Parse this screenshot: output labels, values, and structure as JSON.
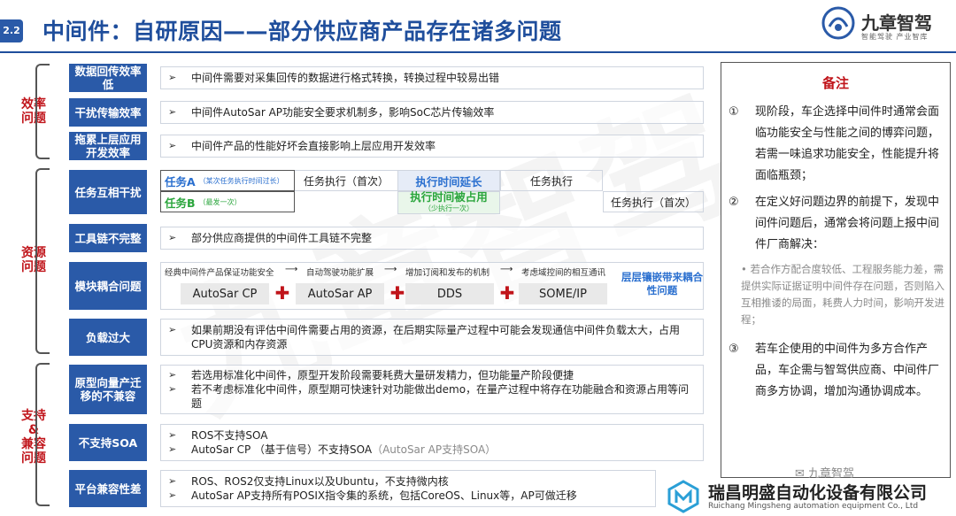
{
  "header": {
    "badge": "2.2",
    "title": "中间件：自研原因——部分供应商产品存在诸多问题",
    "logo_name": "九章智驾",
    "logo_slogan": "智能驾驶 产业智库"
  },
  "watermark": "九章智驾",
  "groups": [
    {
      "label": "效率\n问题"
    },
    {
      "label": "资源\n问题"
    },
    {
      "label": "支持\n&\n兼容\n问题"
    }
  ],
  "rows": {
    "r1": {
      "label": "数据回传效率低",
      "text": "中间件需要对采集回传的数据进行格式转换，转换过程中较易出错"
    },
    "r2": {
      "label": "干扰传输效率",
      "text": "中间件AutoSar AP功能安全要求机制多，影响SoC芯片传输效率"
    },
    "r3": {
      "label": "拖累上层应用开发效率",
      "text": "中间件产品的性能好坏会直接影响上层应用开发效率"
    },
    "r4": {
      "label": "任务互相干扰",
      "taskA": "任务A",
      "taskA_note": "（某次任务执行时间过长）",
      "taskB": "任务B",
      "taskB_note": "（最发一次）",
      "exec_first_a": "任务执行（首次）",
      "time_extend": "执行时间延长",
      "time_occupied": "执行时间被占用",
      "time_occupied_note": "（少执行一次）",
      "exec_a": "任务执行",
      "exec_first_b": "任务执行（首次）"
    },
    "r5": {
      "label": "工具链不完整",
      "text": "部分供应商提供的中间件工具链不完整"
    },
    "r6": {
      "label": "模块耦合问题",
      "chain": [
        "经典中间件产品保证功能安全",
        "自动驾驶功能扩展",
        "增加订阅和发布的机制",
        "考虑域控间的相互通讯"
      ],
      "modules": [
        "AutoSar CP",
        "AutoSar AP",
        "DDS",
        "SOME/IP"
      ],
      "side_note": "层层镶嵌带来耦合性问题"
    },
    "r7": {
      "label": "负载过大",
      "text": "如果前期没有评估中间件需要占用的资源，在后期实际量产过程中可能会发现通信中间件负载太大，占用CPU资源和内存资源"
    },
    "r8": {
      "label": "原型向量产迁移的不兼容",
      "lines": [
        "若选用标准化中间件，原型开发阶段需要耗费大量研发精力，但功能量产阶段便捷",
        "若不考虑标准化中间件，原型期可快速针对功能做出demo，在量产过程中将存在功能融合和资源占用等问题"
      ]
    },
    "r9": {
      "label": "不支持SOA",
      "line1": "ROS不支持SOA",
      "line2_main": "AutoSar CP （基于信号）不支持SOA",
      "line2_muted": "（AutoSar AP支持SOA）"
    },
    "r10": {
      "label": "平台兼容性差",
      "lines": [
        "ROS、ROS2仅支持Linux以及Ubuntu，不支持微内核",
        "AutoSar AP支持所有POSIX指令集的系统，包括CoreOS、Linux等，AP可做迁移"
      ]
    }
  },
  "notes": {
    "title": "备注",
    "items": [
      {
        "num": "①",
        "text": "现阶段，车企选择中间件时通常会面临功能安全与性能之间的博弈问题，若需一味追求功能安全，性能提升将面临瓶颈；"
      },
      {
        "num": "②",
        "text": "在定义好问题边界的前提下，发现中间件问题后，通常会将问题上报中间件厂商解决："
      },
      {
        "num": "③",
        "text": "若车企使用的中间件为多方合作产品，车企需与智驾供应商、中间件厂商多方协调，增加沟通协调成本。"
      }
    ],
    "subnote": "若合作方配合度较低、工程服务能力差，需提供实际证据证明中间件存在问题，否则陷入互相推诿的局面，耗费人力时间，影响开发进程；"
  },
  "footer": {
    "wechat": "九章智驾",
    "company_name": "瑞昌明盛自动化设备有限公司",
    "company_en": "Ruichang Mingsheng automation equipment Co., Ltd"
  },
  "colors": {
    "brand_blue": "#2a5aa8",
    "title_blue": "#1f4e9c",
    "alert_red": "#c0141a",
    "task_green": "#2aa53c"
  },
  "icons": [
    "arrow-bullet-icon",
    "plus-icon",
    "arrow-right-icon",
    "logo-mark-icon",
    "company-mark-icon",
    "wechat-icon"
  ]
}
